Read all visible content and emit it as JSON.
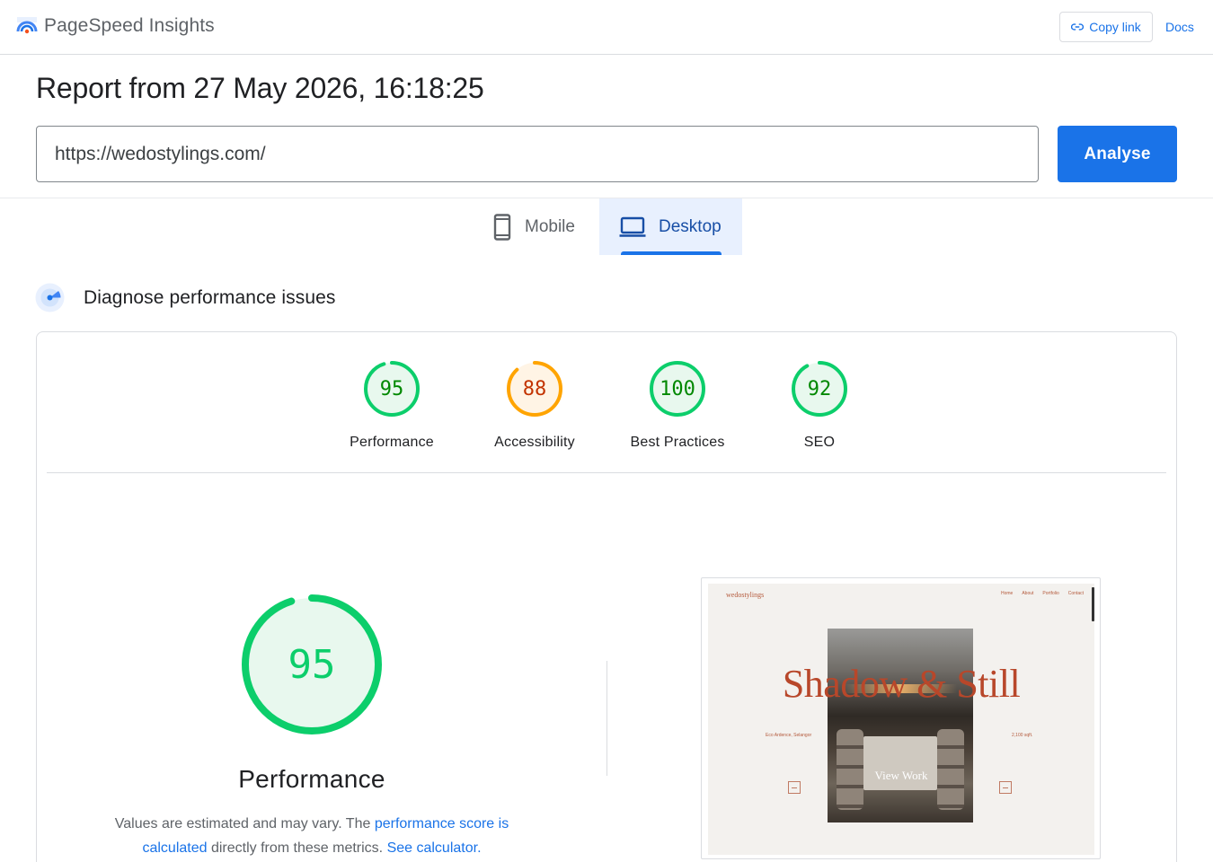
{
  "app": {
    "title": "PageSpeed Insights",
    "copy_link_label": "Copy link",
    "docs_label": "Docs"
  },
  "report": {
    "title": "Report from 27 May 2026, 16:18:25",
    "url": "https://wedostylings.com/",
    "analyse_label": "Analyse"
  },
  "tabs": [
    {
      "label": "Mobile",
      "icon": "smartphone-icon",
      "active": false
    },
    {
      "label": "Desktop",
      "icon": "laptop-icon",
      "active": true
    }
  ],
  "section": {
    "title": "Diagnose performance issues"
  },
  "scores": [
    {
      "label": "Performance",
      "score": "95",
      "fraction": 0.95,
      "status": "pass"
    },
    {
      "label": "Accessibility",
      "score": "88",
      "fraction": 0.88,
      "status": "average"
    },
    {
      "label": "Best Practices",
      "score": "100",
      "fraction": 1.0,
      "status": "pass"
    },
    {
      "label": "SEO",
      "score": "92",
      "fraction": 0.92,
      "status": "pass"
    }
  ],
  "main_gauge": {
    "score": "95",
    "fraction": 0.95,
    "label": "Performance"
  },
  "note": {
    "text1": "Values are estimated and may vary. The ",
    "link1": "performance score is calculated",
    "text2": " directly from these metrics. ",
    "link2": "See calculator."
  },
  "preview": {
    "brand": "wedostylings",
    "nav": [
      "Home",
      "About",
      "Portfolio",
      "Contact"
    ],
    "headline": "Shadow & Still",
    "left_caption": "Eco Ardence, Selangor",
    "right_caption": "2,100 sqft.",
    "cta": "View Work"
  },
  "colors": {
    "pass": "#0cce6b",
    "pass_text": "#008800",
    "pass_bg": "#e8f8ee",
    "average": "#ffa400",
    "average_text": "#c33300",
    "average_bg": "#fff4e5",
    "accent": "#1a73e8"
  }
}
